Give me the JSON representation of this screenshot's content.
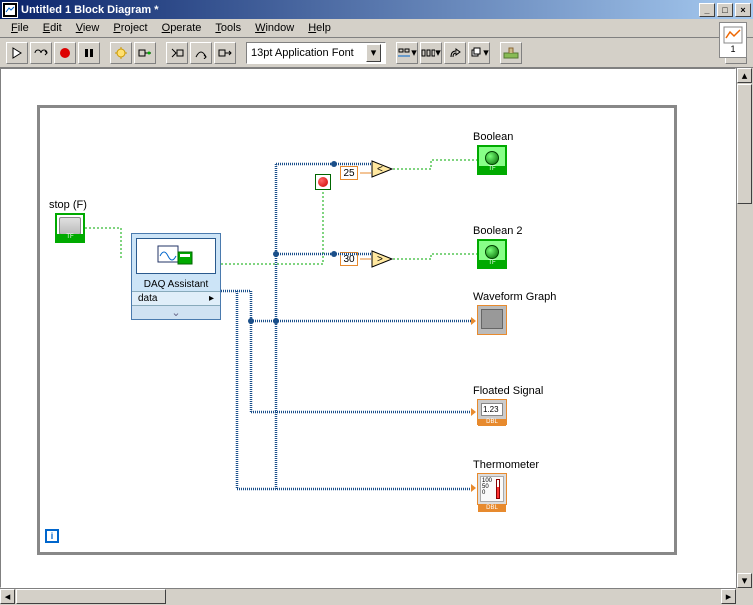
{
  "window": {
    "title": "Untitled 1 Block Diagram *"
  },
  "menu": {
    "file": "File",
    "edit": "Edit",
    "view": "View",
    "project": "Project",
    "operate": "Operate",
    "tools": "Tools",
    "window": "Window",
    "help": "Help"
  },
  "toolbar": {
    "font_display": "13pt Application Font"
  },
  "diagram": {
    "stop_label": "stop (F)",
    "stop_tf": "TF",
    "daq_title": "DAQ Assistant",
    "daq_data": "data",
    "const1": "25",
    "const2": "30",
    "bool1_label": "Boolean",
    "bool1_tf": "TF",
    "bool2_label": "Boolean 2",
    "bool2_tf": "TF",
    "graph_label": "Waveform Graph",
    "float_label": "Floated Signal",
    "float_val": "1.23",
    "float_dbl": "DBL",
    "therm_label": "Thermometer",
    "therm_top": "100",
    "therm_mid": "50",
    "therm_bot": "0",
    "therm_dbl": "DBL",
    "iteration": "i",
    "nav_index": "1"
  }
}
